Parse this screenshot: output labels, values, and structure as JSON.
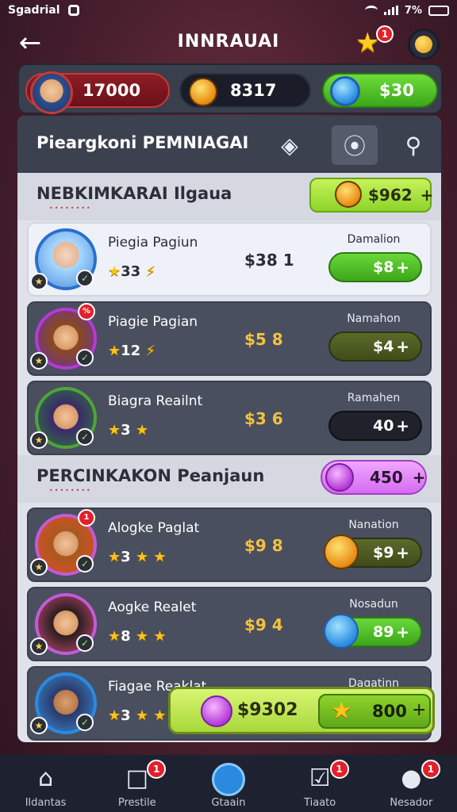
{
  "status": {
    "carrier": "Sgadrial",
    "battery": "7%"
  },
  "header": {
    "title": "INNRAUAI",
    "star_badge": "1"
  },
  "resources": {
    "hearts": "17000",
    "coins": "8317",
    "gems": "$30"
  },
  "panel": {
    "title": "Pieargkoni PEMNIAGAI"
  },
  "sections": [
    {
      "title": "NEBKIMKARAI Ilgaua",
      "sub": "••••••••",
      "pill_value": "$962",
      "pill_plus": "+"
    },
    {
      "title": "PERCINKAKON Peanjaun",
      "sub": "••••••••",
      "pill_value": "450",
      "pill_plus": "+"
    }
  ],
  "rows": [
    {
      "name": "Piegia Pagiun",
      "level": "33",
      "price": "$38 1",
      "action_label": "Damalion",
      "action_value": "$8",
      "plus": "+",
      "badge": ""
    },
    {
      "name": "Piagie Pagian",
      "level": "12",
      "price": "$5 8",
      "action_label": "Namahon",
      "action_value": "$4",
      "plus": "+",
      "badge": "%"
    },
    {
      "name": "Biagra Reailnt",
      "level": "3",
      "price": "$3 6",
      "action_label": "Ramahen",
      "action_value": "40",
      "plus": "+",
      "badge": ""
    },
    {
      "name": "Alogke Paglat",
      "level": "3",
      "price": "$9 8",
      "action_label": "Nanation",
      "action_value": "$9",
      "plus": "+",
      "badge": "1"
    },
    {
      "name": "Aogke Realet",
      "level": "8",
      "price": "$9 4",
      "action_label": "Nosadun",
      "action_value": "89",
      "plus": "+",
      "badge": ""
    },
    {
      "name": "Fiagae Reaklat",
      "level": "3",
      "price": "",
      "action_label": "Dagatinn",
      "action_value": "",
      "plus": "",
      "badge": ""
    }
  ],
  "promo": {
    "value1": "$9302",
    "value2": "800",
    "plus": "+"
  },
  "nav": [
    {
      "label": "Ildantas",
      "badge": ""
    },
    {
      "label": "Prestile",
      "badge": "1"
    },
    {
      "label": "Gtaain",
      "badge": ""
    },
    {
      "label": "Tiaato",
      "badge": "1"
    },
    {
      "label": "Nesador",
      "badge": "1"
    }
  ]
}
